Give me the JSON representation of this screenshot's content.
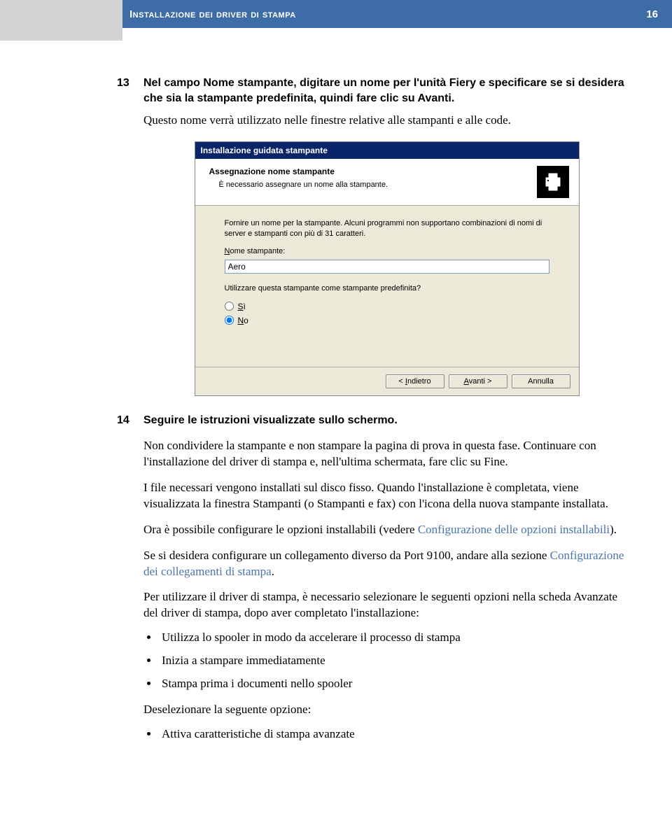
{
  "header": {
    "title": "Installazione dei driver di stampa",
    "page_number": "16"
  },
  "step13": {
    "number": "13",
    "bold_text": "Nel campo Nome stampante, digitare un nome per l'unità Fiery e specificare se si desidera che sia la stampante predefinita, quindi fare clic su Avanti.",
    "plain_text": "Questo nome verrà utilizzato nelle finestre relative alle stampanti e alle code."
  },
  "wizard": {
    "title": "Installazione guidata stampante",
    "head1": "Assegnazione nome stampante",
    "head2": "È necessario assegnare un nome alla stampante.",
    "body_intro": "Fornire un nome per la stampante. Alcuni programmi non supportano combinazioni di nomi di server e stampanti con più di 31 caratteri.",
    "name_label": "Nome stampante:",
    "name_value": "Aero",
    "default_question": "Utilizzare questa stampante come stampante predefinita?",
    "yes_label": "Sì",
    "no_label": "No",
    "btn_back": "< Indietro",
    "btn_next": "Avanti >",
    "btn_cancel": "Annulla"
  },
  "step14": {
    "number": "14",
    "bold_text": "Seguire le istruzioni visualizzate sullo schermo.",
    "para1": "Non condividere la stampante e non stampare la pagina di prova in questa fase. Continuare con l'installazione del driver di stampa e, nell'ultima schermata, fare clic su Fine.",
    "para2": "I file necessari vengono installati sul disco fisso. Quando l'installazione è completata, viene visualizzata la finestra Stampanti (o Stampanti e fax) con l'icona della nuova stampante installata.",
    "para3_prefix": "Ora è possibile configurare le opzioni installabili (vedere ",
    "para3_link": "Configurazione delle opzioni installabili",
    "para3_suffix": ").",
    "para4_prefix": "Se si desidera configurare un collegamento diverso da Port 9100, andare alla sezione ",
    "para4_link": "Configurazione dei collegamenti di stampa",
    "para4_suffix": ".",
    "para5": "Per utilizzare il driver di stampa, è necessario selezionare le seguenti opzioni nella scheda Avanzate del driver di stampa, dopo aver completato l'installazione:",
    "bullets": [
      "Utilizza lo spooler in modo da accelerare il processo di stampa",
      "Inizia a stampare immediatamente",
      "Stampa prima i documenti nello spooler"
    ],
    "deselect_label": "Deselezionare la seguente opzione:",
    "deselect_bullet": "Attiva caratteristiche di stampa avanzate"
  }
}
